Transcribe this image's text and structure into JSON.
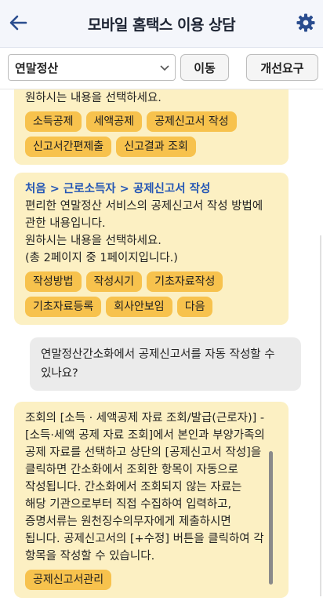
{
  "header": {
    "title": "모바일 홈택스 이용 상담"
  },
  "toolbar": {
    "category_selected": "연말정산",
    "move_label": "이동",
    "improve_label": "개선요구"
  },
  "messages": {
    "bot1": {
      "prompt": "원하시는 내용을 선택하세요.",
      "chips": [
        "소득공제",
        "세액공제",
        "공제신고서 작성",
        "신고서간편제출",
        "신고결과 조회"
      ]
    },
    "bot2": {
      "breadcrumb": "처음 > 근로소득자 > 공제신고서 작성",
      "lines": [
        "편리한 연말정산 서비스의 공제신고서 작성 방법에",
        "관한 내용입니다.",
        "원하시는 내용을 선택하세요.",
        "(총 2페이지 중 1페이지입니다.)"
      ],
      "chips": [
        "작성방법",
        "작성시기",
        "기초자료작성",
        "기초자료등록",
        "회사안보임",
        "다음"
      ]
    },
    "user1": {
      "lines": [
        "연말정산간소화에서 공제신고서를 자동 작성할 수",
        "있나요?"
      ]
    },
    "bot3": {
      "lines": [
        "조회의 [소득 · 세액공제 자료 조회/발급(근로자)] -",
        "[소득·세액 공제 자료 조회]에서 본인과 부양가족의",
        "공제 자료를 선택하고 상단의 [공제신고서 작성]을",
        "클릭하면 간소화에서 조회한 항목이 자동으로",
        "작성됩니다. 간소화에서 조회되지 않는 자료는",
        "해당 기관으로부터 직접 수집하여 입력하고,",
        "증명서류는 원천징수의무자에게 제출하시면",
        "됩니다. 공제신고서의 [+수정] 버튼을 클릭하여 각",
        "항목을 작성할 수 있습니다."
      ],
      "chips": [
        "공제신고서관리"
      ]
    }
  },
  "colors": {
    "bot_bubble": "#fcf0c3",
    "chip": "#f7c24d",
    "user_bubble": "#ebebeb",
    "breadcrumb": "#2456b5",
    "accent_icon": "#2a4d8f"
  }
}
